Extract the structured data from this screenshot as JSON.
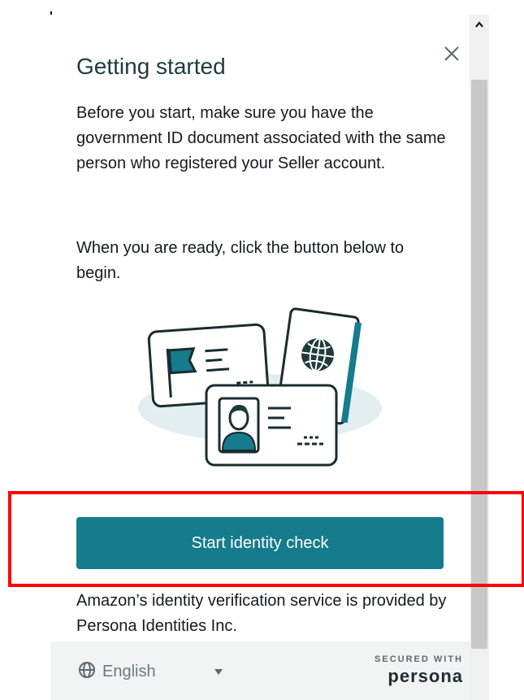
{
  "dialog": {
    "title": "Getting started",
    "paragraph1": "Before you start, make sure you have the government ID document associated with the same person who registered your Seller account.",
    "paragraph2": "When you are ready, click the button below to begin.",
    "cta_label": "Start identity check",
    "footer_note": "Amazon’s identity verification service is provided by Persona Identities Inc.",
    "close_icon": "close-icon",
    "illustration": "id-documents-illustration"
  },
  "footer": {
    "language": "English",
    "globe_icon": "globe-icon",
    "secured_label": "SECURED WITH",
    "brand": "persona"
  },
  "colors": {
    "primary": "#147c8c",
    "highlight": "#ff0000",
    "footer_bg": "#f2f3f3",
    "title": "#1f3b3b"
  }
}
